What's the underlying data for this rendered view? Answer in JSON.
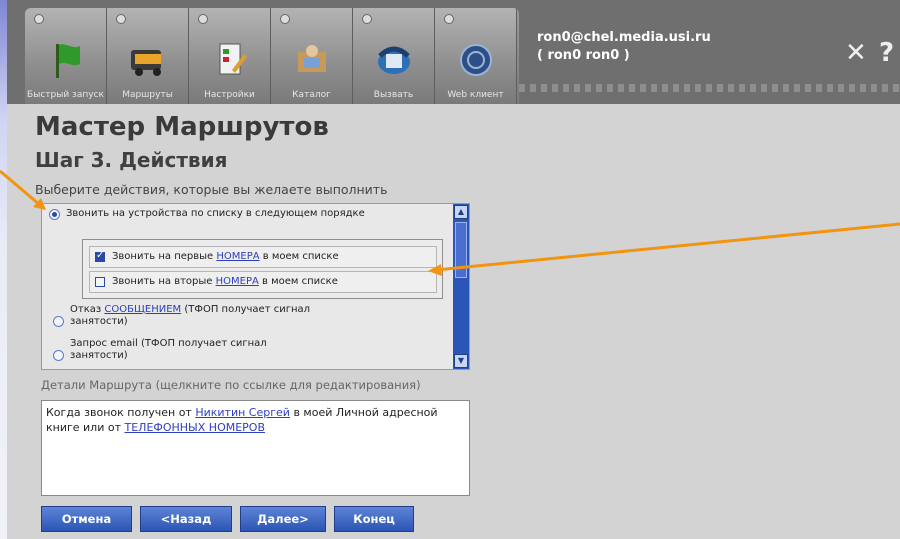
{
  "toolbar": {
    "buttons": [
      {
        "label": "Быстрый запуск",
        "icon": "flag-icon"
      },
      {
        "label": "Маршруты",
        "icon": "routes-icon"
      },
      {
        "label": "Настройки",
        "icon": "settings-icon"
      },
      {
        "label": "Каталог",
        "icon": "catalog-icon"
      },
      {
        "label": "Вызвать",
        "icon": "phone-icon"
      },
      {
        "label": "Web клиент",
        "icon": "web-client-icon"
      }
    ]
  },
  "user": {
    "email": "ron0@chel.media.usi.ru",
    "name": "( ron0 ron0 )"
  },
  "controls": {
    "close": "✕",
    "help": "?"
  },
  "wizard": {
    "title": "Мастер Маршрутов",
    "step": "Шаг 3. Действия",
    "prompt": "Выберите действия, которые вы желаете выполнить"
  },
  "actions": {
    "option1": "Звонить на устройства по списку в следующем порядке",
    "sub1_pre": "Звонить на первые",
    "sub1_link": "НОМЕРА",
    "sub1_post": "в моем списке",
    "sub2_pre": "Звонить на вторые",
    "sub2_link": "НОМЕРА",
    "sub2_post": "в моем списке",
    "option2_pre": "Отказ",
    "option2_link": "СООБЩЕНИЕМ",
    "option2_post": "(ТФОП получает сигнал занятости)",
    "option3": "Запрос email (ТФОП получает сигнал занятости)"
  },
  "details": {
    "label": "Детали Маршрута (щелкните по ссылке для редактирования)",
    "text_pre": "Когда звонок получен от",
    "link1": "Никитин Сергей",
    "text_mid": "в моей Личной адресной книге или от",
    "link2": "ТЕЛЕФОННЫХ НОМЕРОВ"
  },
  "buttons": {
    "cancel": "Отмена",
    "back": "<Назад",
    "next": "Далее>",
    "finish": "Конец"
  },
  "colors": {
    "arrow": "#f29410",
    "link": "#2d3fbf",
    "button": "#2c55b5"
  }
}
